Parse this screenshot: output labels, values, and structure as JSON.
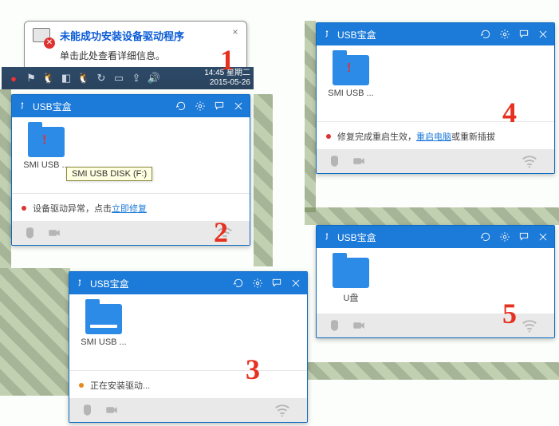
{
  "balloon": {
    "title": "未能成功安装设备驱动程序",
    "subtitle": "单击此处查看详细信息。",
    "close": "×"
  },
  "taskbar": {
    "time": "14:45 星期二",
    "date": "2015-05-26"
  },
  "panels": {
    "common": {
      "title": "USB宝盒"
    },
    "p2": {
      "drive_label": "SMI USB ...",
      "tooltip": "SMI USB DISK (F:)",
      "status_prefix": "设备驱动异常，点击",
      "status_link": "立即修复"
    },
    "p3": {
      "drive_label": "SMI USB ...",
      "status": "正在安装驱动..."
    },
    "p4": {
      "drive_label": "SMI USB ...",
      "status_prefix": "修复完成重启生效，",
      "status_link": "重启电脑",
      "status_suffix": "或重新插拔"
    },
    "p5": {
      "drive_label": "U盘"
    }
  },
  "annotations": {
    "a1": "1",
    "a2": "2",
    "a3": "3",
    "a4": "4",
    "a5": "5"
  }
}
